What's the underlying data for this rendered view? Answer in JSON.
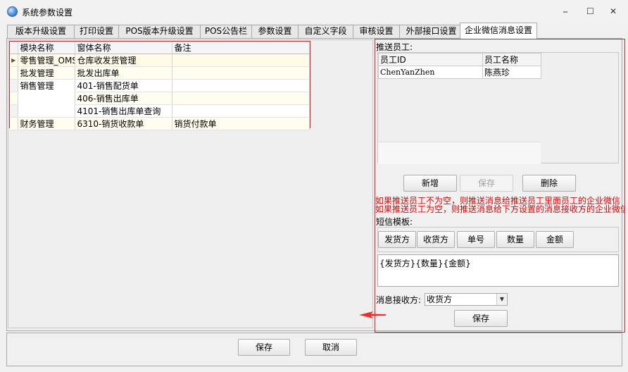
{
  "window": {
    "title": "系统参数设置",
    "controls": {
      "minimize": "⎯",
      "maximize": "☐",
      "close": "✕"
    }
  },
  "tabs": [
    {
      "label": "版本升级设置"
    },
    {
      "label": "打印设置"
    },
    {
      "label": "POS版本升级设置"
    },
    {
      "label": "POS公告栏"
    },
    {
      "label": "参数设置"
    },
    {
      "label": "自定义字段"
    },
    {
      "label": "审核设置"
    },
    {
      "label": "外部接口设置"
    },
    {
      "label": "企业微信消息设置",
      "active": true
    }
  ],
  "module_grid": {
    "headers": {
      "module": "模块名称",
      "form": "窗体名称",
      "note": "备注"
    },
    "rows": [
      {
        "module": "零售管理_OMS",
        "form": "仓库收发货管理",
        "note": "",
        "current": true
      },
      {
        "module": "批发管理",
        "form": "批发出库单",
        "note": ""
      },
      {
        "module": "销售管理",
        "form": "401-销售配货单",
        "note": ""
      },
      {
        "module": "",
        "form": "406-销售出库单",
        "note": ""
      },
      {
        "module": "",
        "form": "4101-销售出库单查询",
        "note": ""
      },
      {
        "module": "财务管理",
        "form": "6310-销货收款单",
        "note": "销货付款单"
      }
    ]
  },
  "push_employees": {
    "label": "推送员工:",
    "headers": {
      "id": "员工ID",
      "name": "员工名称"
    },
    "rows": [
      {
        "id": "ChenYanZhen",
        "name": "陈燕珍"
      }
    ],
    "buttons": {
      "add": "新增",
      "save": "保存",
      "delete": "删除"
    }
  },
  "warnings": [
    "如果推送员工不为空，则推送消息给推送员工里面员工的企业微信",
    "如果推送员工为空，则推送消息给下方设置的消息接收方的企业微信"
  ],
  "sms_template": {
    "label": "短信模板:",
    "field_buttons": [
      "发货方",
      "收货方",
      "单号",
      "数量",
      "金额"
    ],
    "content": "{发货方}{数量}{金额}"
  },
  "receiver": {
    "label": "消息接收方:",
    "value": "收货方",
    "save_label": "保存"
  },
  "footer": {
    "save_label": "保存",
    "cancel_label": "取消"
  },
  "colors": {
    "highlight_border": "#e02020",
    "warning_text": "#e00000",
    "annotation_arrow": "#e8312a"
  },
  "icons": {
    "title": "app-globe-icon",
    "row_indicator": "row-pointer-icon",
    "dropdown": "chevron-down-icon",
    "annotation": "red-arrow-icon"
  }
}
